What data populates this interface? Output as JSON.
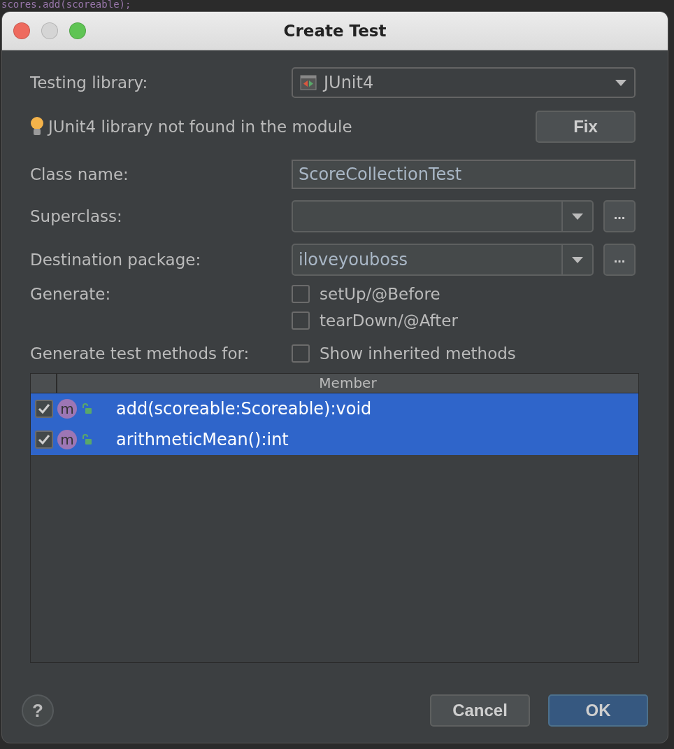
{
  "background_code": "scores.add(scoreable);",
  "window": {
    "title": "Create Test"
  },
  "form": {
    "testing_library": {
      "label": "Testing library:",
      "value": "JUnit4"
    },
    "warning": {
      "text": "JUnit4 library not found in the module",
      "fix_button": "Fix"
    },
    "class_name": {
      "label": "Class name:",
      "value": "ScoreCollectionTest"
    },
    "superclass": {
      "label": "Superclass:",
      "browse": "..."
    },
    "destination_package": {
      "label": "Destination package:",
      "value": "iloveyouboss",
      "browse": "..."
    },
    "generate": {
      "label": "Generate:",
      "options": [
        {
          "label": "setUp/@Before",
          "checked": false
        },
        {
          "label": "tearDown/@After",
          "checked": false
        }
      ]
    },
    "methods": {
      "label": "Generate test methods for:",
      "show_inherited": {
        "label": "Show inherited methods",
        "checked": false
      }
    }
  },
  "table": {
    "columns": [
      "Member"
    ],
    "rows": [
      {
        "icon": "m",
        "member": "add(scoreable:Scoreable):void",
        "checked": true,
        "selected": true
      },
      {
        "icon": "m",
        "member": "arithmeticMean():int",
        "checked": true,
        "selected": true
      }
    ]
  },
  "buttons": {
    "help": "?",
    "cancel": "Cancel",
    "ok": "OK"
  }
}
